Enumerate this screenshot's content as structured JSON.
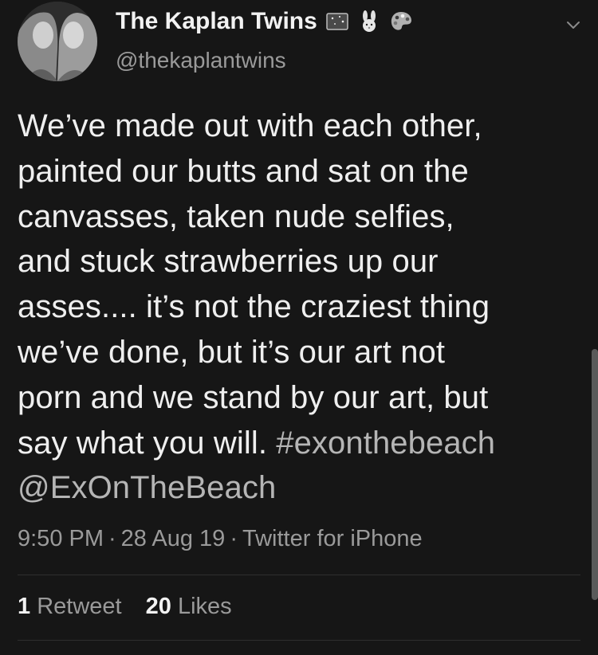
{
  "author": {
    "display_name": "The Kaplan Twins",
    "handle": "@thekaplantwins",
    "name_emojis": [
      "night-sky-emoji",
      "bunny-emoji",
      "artist-palette-emoji"
    ]
  },
  "tweet": {
    "lines": [
      "We’ve made out with each other,",
      "painted our butts and sat on the",
      "canvasses, taken nude selfies,",
      "and stuck strawberries up our",
      "asses.... it’s not the craziest thing",
      "we’ve done, but it’s our art not",
      "porn and we stand by our art, but"
    ],
    "last_line_text": "say what you will. ",
    "hashtag": "#exonthebeach",
    "mention": "@ExOnTheBeach"
  },
  "meta": {
    "time": "9:50 PM",
    "date": "28 Aug 19",
    "source": "Twitter for iPhone",
    "separator": "·"
  },
  "stats": {
    "retweet_count": "1",
    "retweet_label": "Retweet",
    "like_count": "20",
    "like_label": "Likes"
  },
  "colors": {
    "background": "#161616",
    "text": "#efefef",
    "secondary": "#9a9a9a",
    "link": "#b5b5b5"
  },
  "icons": {
    "menu": "chevron-down-icon",
    "avatar": "profile-photo"
  }
}
